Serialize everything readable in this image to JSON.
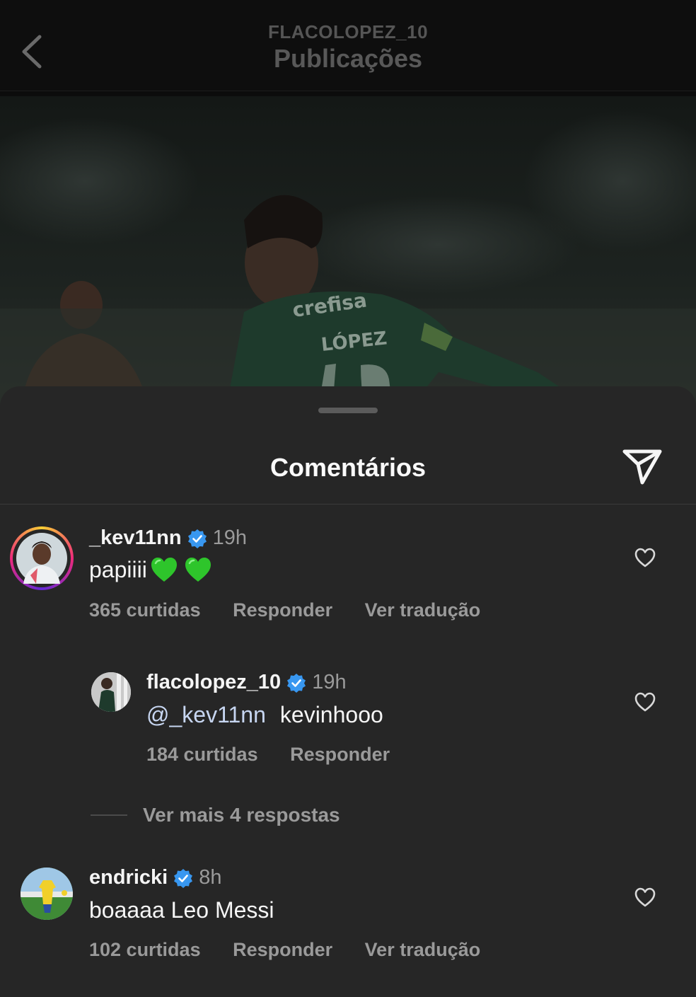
{
  "header": {
    "username": "FLACOLOPEZ_10",
    "title": "Publicações"
  },
  "post_photo": {
    "description_icon": "player-photo",
    "jersey_sponsor": "crefisa",
    "jersey_name": "LÓPEZ"
  },
  "comments_sheet": {
    "title": "Comentários",
    "comments": [
      {
        "username": "_kev11nn",
        "time": "19h",
        "text": "papiiii",
        "emoji": "green-heart-emoji green-heart-emoji",
        "likes": "365 curtidas",
        "reply": "Responder",
        "translate": "Ver tradução"
      },
      {
        "username": "flacolopez_10",
        "time": "19h",
        "mention": "@_kev11nn",
        "text": "kevinhooo",
        "likes": "184 curtidas",
        "reply": "Responder"
      },
      {
        "username": "endricki",
        "time": "8h",
        "text": "boaaaa Leo Messi",
        "likes": "102 curtidas",
        "reply": "Responder",
        "translate": "Ver tradução"
      }
    ],
    "more_replies": "Ver mais 4 respostas"
  },
  "colors": {
    "sheet_bg": "#262626",
    "verified_blue": "#3897f0",
    "mention": "#c7d6f1",
    "muted": "#9a9a9a"
  }
}
